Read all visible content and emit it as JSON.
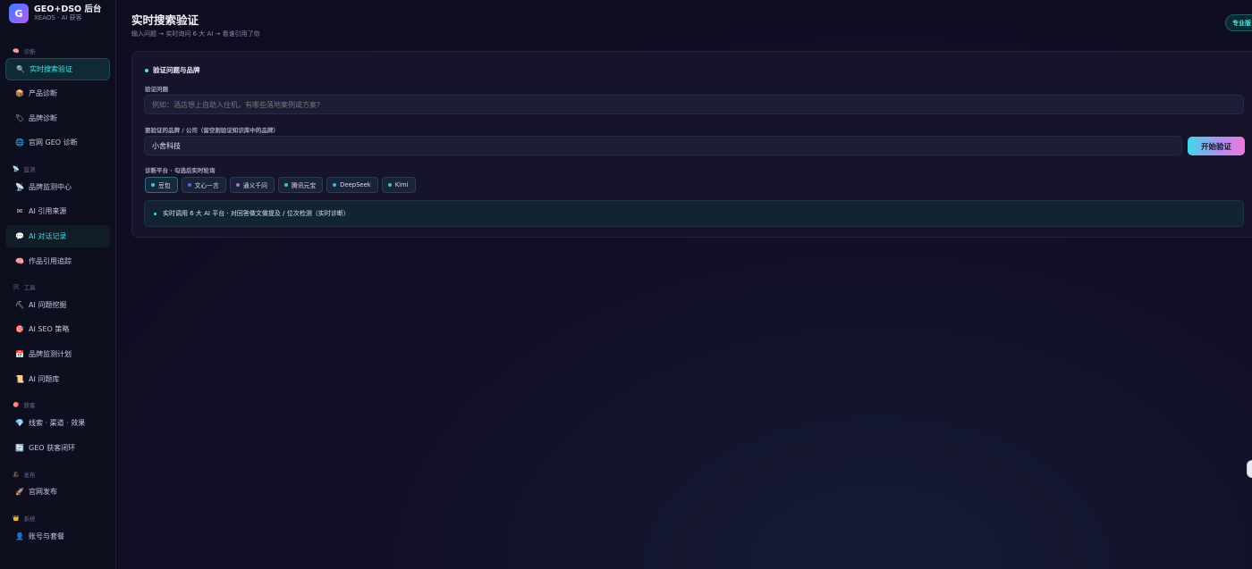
{
  "brand": {
    "logo_letter": "G",
    "title": "GEO+DSO 后台",
    "subtitle": "XEAOS · AI 获客"
  },
  "sidebar": {
    "groups": [
      {
        "title": "诊断",
        "icon": "brain-icon"
      },
      {
        "title": "监测",
        "icon": "antenna-icon"
      },
      {
        "title": "工具",
        "icon": "tools-icon"
      },
      {
        "title": "获客",
        "icon": "target-icon"
      },
      {
        "title": "发布",
        "icon": "hat-icon"
      },
      {
        "title": "系统",
        "icon": "crown-icon"
      }
    ],
    "items": [
      {
        "label": "实时搜索验证",
        "icon": "magnifier-icon",
        "state": "active"
      },
      {
        "label": "产品诊断",
        "icon": "package-icon"
      },
      {
        "label": "品牌诊断",
        "icon": "tag-icon"
      },
      {
        "label": "官网 GEO 诊断",
        "icon": "globe-icon"
      },
      {
        "label": "品牌监测中心",
        "icon": "satellite-icon"
      },
      {
        "label": "AI 引用来源",
        "icon": "envelope-icon"
      },
      {
        "label": "AI 对话记录",
        "icon": "chat-icon",
        "state": "highlight"
      },
      {
        "label": "作品引用追踪",
        "icon": "brain-icon"
      },
      {
        "label": "AI 问题挖掘",
        "icon": "pickaxe-icon"
      },
      {
        "label": "AI SEO 策略",
        "icon": "dart-icon"
      },
      {
        "label": "品牌监测计划",
        "icon": "calendar-icon"
      },
      {
        "label": "AI 问题库",
        "icon": "scroll-icon"
      },
      {
        "label": "线索 · 渠道 · 效果",
        "icon": "gem-icon"
      },
      {
        "label": "GEO 获客闭环",
        "icon": "refresh-icon"
      },
      {
        "label": "官网发布",
        "icon": "rocket-icon"
      },
      {
        "label": "账号与套餐",
        "icon": "user-icon"
      }
    ]
  },
  "header": {
    "title": "实时搜索验证",
    "subtitle": "输入问题 → 实时询问 6 大 AI → 看谁引用了你",
    "badge": "专业版"
  },
  "form": {
    "section_title": "验证问题与品牌",
    "question_label": "验证问题",
    "question_placeholder": "例如：酒店想上自助入住机，有哪些落地案例或方案?",
    "brand_label": "要验证的品牌 / 公司（留空则验证知识库中的品牌）",
    "brand_value": "小舍科技",
    "start_button": "开始验证",
    "platform_label": "诊断平台 · 勾选后实时轮询",
    "platforms": [
      {
        "name": "豆包",
        "color": "#36c6e6"
      },
      {
        "name": "文心一言",
        "color": "#4a6cf0"
      },
      {
        "name": "通义千问",
        "color": "#9b6cf0"
      },
      {
        "name": "腾讯元宝",
        "color": "#36c6e6"
      },
      {
        "name": "DeepSeek",
        "color": "#36b7f0"
      },
      {
        "name": "Kimi",
        "color": "#36c6b0"
      }
    ],
    "info_text": "实时调用 6 大 AI 平台 · 对回答做文做提及 / 位次检测（实时诊断）"
  }
}
